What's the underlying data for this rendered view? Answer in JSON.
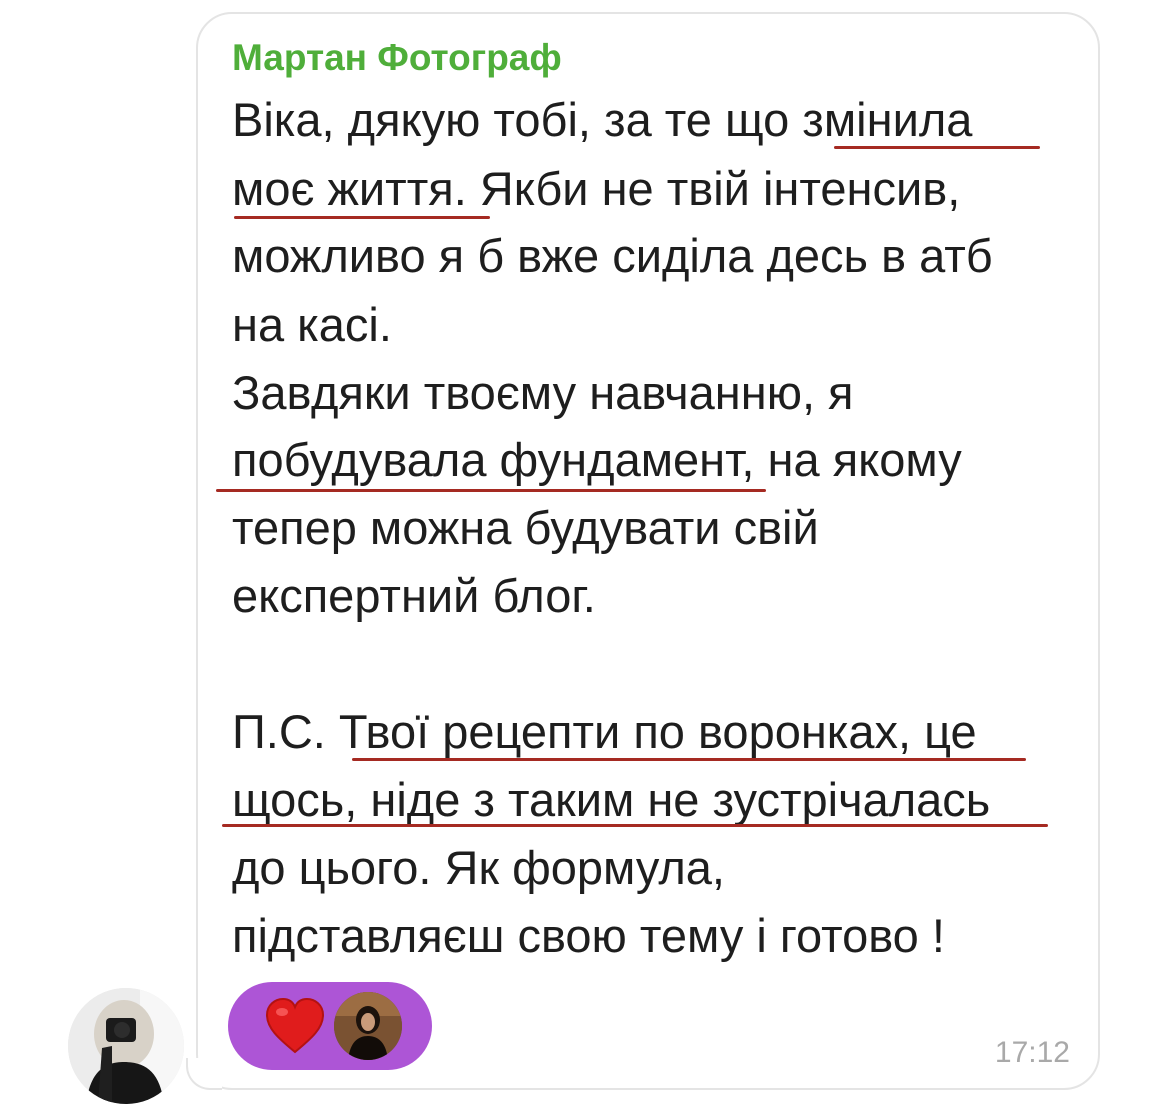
{
  "message": {
    "sender_name": "Мартан Фотограф",
    "lines": [
      "Віка, дякую тобі, за те що змінила",
      "моє життя. Якби не твій інтенсив,",
      "можливо я б вже сиділа десь в атб",
      "на касі.",
      "Завдяки твоєму навчанню, я",
      "побудувала фундамент, на якому",
      "тепер можна будувати свій",
      "експертний блог.",
      "",
      "П.С. Твої рецепти по воронках, це",
      "щось, ніде з таким не зустрічалась",
      "до цього. Як формула,",
      "підставляєш свою тему і готово !"
    ],
    "time": "17:12"
  },
  "reaction": {
    "emoji": "heart-icon",
    "accent_color": "#ad55d6",
    "heart_color": "#e01c1c"
  },
  "colors": {
    "sender": "#4fae3a",
    "text": "#1e1e1e",
    "underline": "#a52a22",
    "timestamp": "#a9a9a9"
  }
}
